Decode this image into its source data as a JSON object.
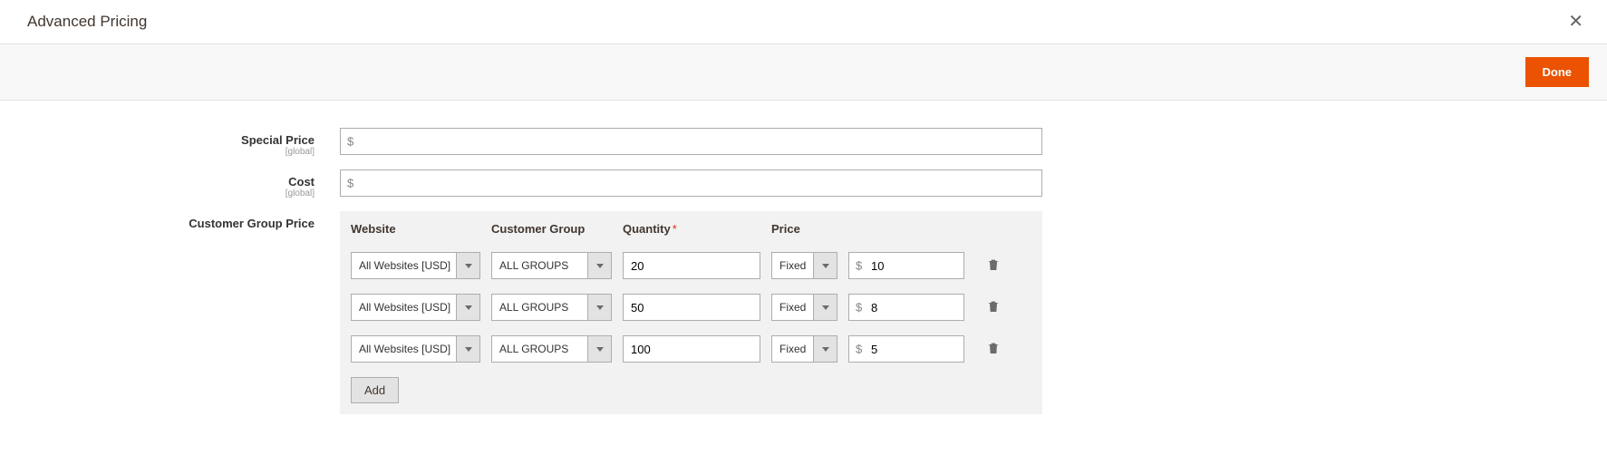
{
  "header": {
    "title": "Advanced Pricing"
  },
  "actions": {
    "done_label": "Done"
  },
  "fields": {
    "special_price_label": "Special Price",
    "special_price_scope": "[global]",
    "special_price_value": "",
    "special_price_prefix": "$",
    "cost_label": "Cost",
    "cost_scope": "[global]",
    "cost_value": "",
    "cost_prefix": "$",
    "group_price_label": "Customer Group Price"
  },
  "group_table": {
    "headers": {
      "website": "Website",
      "group": "Customer Group",
      "quantity": "Quantity",
      "price": "Price"
    },
    "rows": [
      {
        "website": "All Websites [USD]",
        "group": "ALL GROUPS",
        "qty": "20",
        "ptype": "Fixed",
        "currency": "$",
        "price": "10"
      },
      {
        "website": "All Websites [USD]",
        "group": "ALL GROUPS",
        "qty": "50",
        "ptype": "Fixed",
        "currency": "$",
        "price": "8"
      },
      {
        "website": "All Websites [USD]",
        "group": "ALL GROUPS",
        "qty": "100",
        "ptype": "Fixed",
        "currency": "$",
        "price": "5"
      }
    ],
    "add_label": "Add"
  }
}
